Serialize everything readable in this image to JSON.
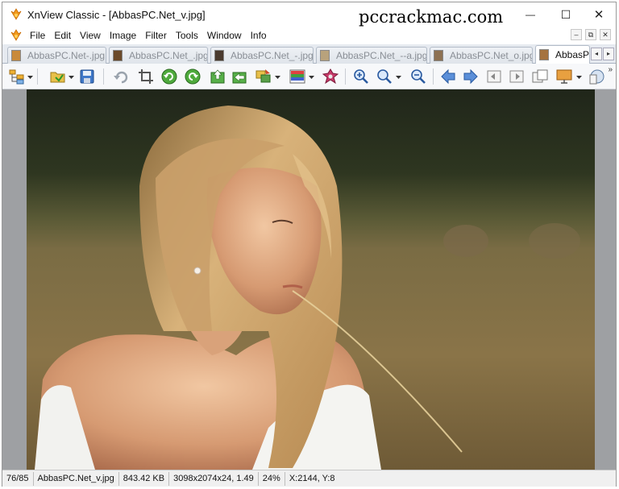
{
  "window": {
    "title": "XnView Classic - [AbbasPC.Net_v.jpg]",
    "watermark": "pccrackmac.com",
    "minimize_glyph": "—",
    "maximize_glyph": "☐",
    "close_glyph": "✕"
  },
  "menubar": {
    "items": [
      "File",
      "Edit",
      "View",
      "Image",
      "Filter",
      "Tools",
      "Window",
      "Info"
    ],
    "mdi_controls": [
      "–",
      "⧉",
      "✕"
    ]
  },
  "tabs": [
    {
      "label": "AbbasPC.Net-.jpg",
      "thumb_color": "#c98a3a",
      "active": false
    },
    {
      "label": "AbbasPC.Net_.jpg",
      "thumb_color": "#6b4a2a",
      "active": false
    },
    {
      "label": "AbbasPC.Net_-.jpg",
      "thumb_color": "#4a3a2e",
      "active": false
    },
    {
      "label": "AbbasPC.Net_--a.jpg",
      "thumb_color": "#b8a27c",
      "active": false
    },
    {
      "label": "AbbasPC.Net_o.jpg",
      "thumb_color": "#8d7152",
      "active": false
    },
    {
      "label": "AbbasP(",
      "thumb_color": "#a5733f",
      "active": true
    }
  ],
  "tab_scroll": {
    "left": "◂",
    "right": "▸"
  },
  "toolbar": {
    "more_glyph": "»",
    "icons": [
      "browser-icon",
      "open-folder-icon",
      "save-icon",
      "undo-icon",
      "crop-icon",
      "rotate-left-icon",
      "rotate-right-icon",
      "export-icon",
      "import-icon",
      "batch-icon",
      "adjust-colors-icon",
      "red-eye-icon",
      "zoom-in-icon",
      "zoom-fit-icon",
      "zoom-out-icon",
      "previous-icon",
      "next-icon",
      "first-page-icon",
      "last-page-icon",
      "copy-icon",
      "slideshow-icon",
      "properties-icon"
    ]
  },
  "colors": {
    "accent": "#1e6fd9",
    "viewer_background": "#9ea0a3"
  },
  "statusbar": {
    "position": "76/85",
    "filename": "AbbasPC.Net_v.jpg",
    "filesize": "843.42 KB",
    "dimensions": "3098x2074x24, 1.49",
    "zoom": "24%",
    "cursor": "X:2144, Y:8"
  }
}
